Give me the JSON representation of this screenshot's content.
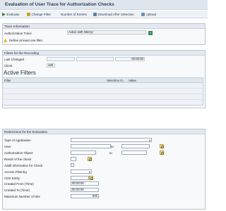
{
  "window": {
    "title": "Evaluation of User Trace for Authorization Checks"
  },
  "toolbar": {
    "evaluate": "Evaluate",
    "change_filter": "Change Filter",
    "number_of_entries": "Number of Entries",
    "download_after_selection": "Download After Selection",
    "upload": "Upload"
  },
  "trace_info": {
    "heading": "Trace Information",
    "auth_trace_label": "Authorization Trace",
    "auth_trace_value": "Active with filter(s)",
    "warning": "Define at least one filter"
  },
  "filters_recording": {
    "heading": "Filters for the Recording",
    "last_changed_label": "Last Changed",
    "last_changed_time": "00:00:00",
    "client_label": "Client",
    "client_value": "100",
    "active_filters_title": "Active Filters",
    "columns": [
      "Filter",
      "Selection O...",
      "Value"
    ]
  },
  "restrictions": {
    "heading": "Restrictions for the Evaluation",
    "type_of_application": "Type of Application",
    "user": "User",
    "authorization_object": "Authorization Object",
    "result_of_check": "Result of the check",
    "addtl_info": "Addtl Information for Check",
    "access_filtering": "Access Filtering",
    "cds_entity": "CDS Entity",
    "created_from": "Created From (Time)",
    "created_from_value": "00:00:00",
    "created_to": "Created To (Time)",
    "created_to_value": "00:00:00",
    "max_hits": "Maximum Number of Hits",
    "max_hits_value": "500",
    "to_label": "to"
  },
  "colors": {
    "title_bg": "#dfe6ee",
    "section_bg": "#f7f9fb",
    "accent": "#2d3e55"
  }
}
